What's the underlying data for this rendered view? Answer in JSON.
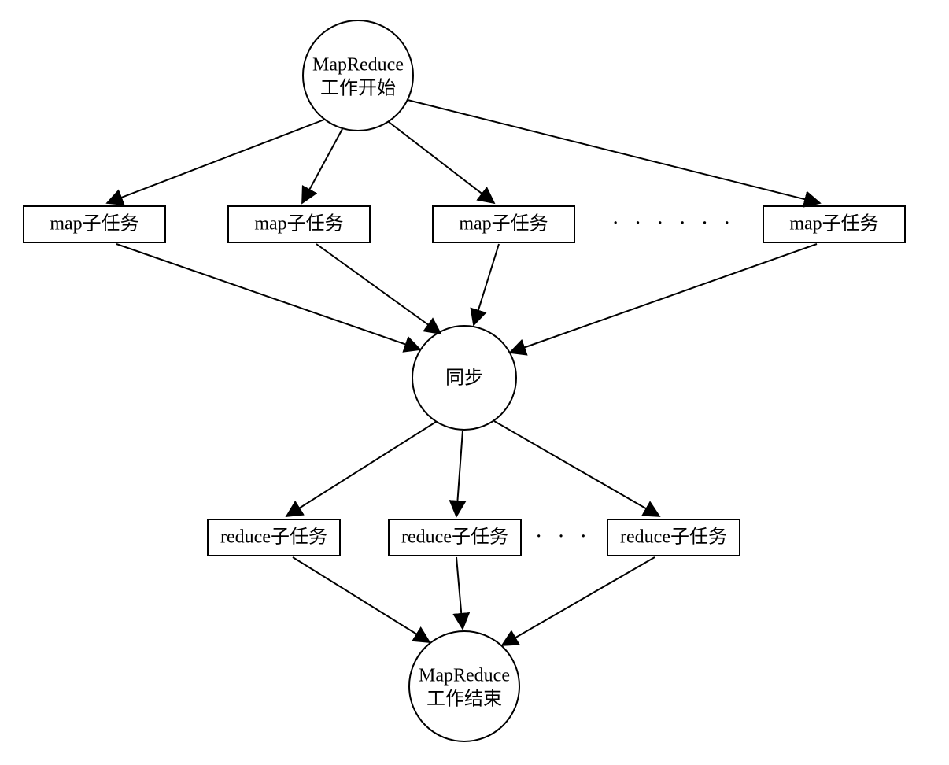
{
  "start": {
    "line1": "MapReduce",
    "line2": "工作开始"
  },
  "sync": {
    "label": "同步"
  },
  "end": {
    "line1": "MapReduce",
    "line2": "工作结束"
  },
  "mapTasks": {
    "labels": [
      "map子任务",
      "map子任务",
      "map子任务",
      "map子任务"
    ],
    "ellipsis": "· · · · · ·"
  },
  "reduceTasks": {
    "labels": [
      "reduce子任务",
      "reduce子任务",
      "reduce子任务"
    ],
    "ellipsis": "· · ·"
  }
}
